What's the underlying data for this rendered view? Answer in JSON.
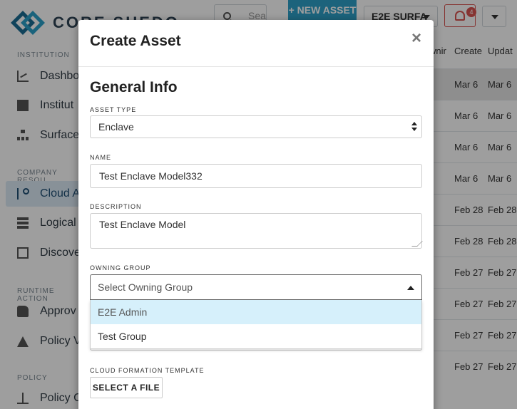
{
  "header": {
    "logo_text": "CORE SUEDO",
    "search_placeholder": "Sea",
    "new_asset_label": "+ NEW ASSET",
    "org_selector": "E2E SURFA",
    "notification_count": "4"
  },
  "sidebar": {
    "sections": [
      {
        "title": "INSTITUTION",
        "items": [
          {
            "label": "Dashbo",
            "icon": "chart-icon"
          },
          {
            "label": "Institut",
            "icon": "building-icon"
          },
          {
            "label": "Surface",
            "icon": "network-icon"
          }
        ]
      },
      {
        "title": "COMPANY RESOU",
        "items": [
          {
            "label": "Cloud A",
            "icon": "branch-icon"
          },
          {
            "label": "Logical",
            "icon": "server-icon"
          },
          {
            "label": "Discove",
            "icon": "discover-icon"
          }
        ]
      },
      {
        "title": "RUNTIME ACTION",
        "items": [
          {
            "label": "Approv",
            "icon": "thumbs-up-icon"
          },
          {
            "label": "Policy V",
            "icon": "warning-icon"
          }
        ]
      },
      {
        "title": "POLICY",
        "items": [
          {
            "label": "Policy C",
            "icon": "scale-icon"
          }
        ]
      }
    ]
  },
  "table": {
    "headers": [
      "wnir",
      "Create",
      "Updat"
    ],
    "rows": [
      {
        "created": "Mar 6",
        "updated": "Mar 6"
      },
      {
        "created": "Mar 6",
        "updated": "Mar 6"
      },
      {
        "created": "Mar 6",
        "updated": "Mar 6"
      },
      {
        "created": "Mar 6",
        "updated": "Mar 6"
      },
      {
        "created": "Feb 28",
        "updated": "Feb 28"
      },
      {
        "created": "Feb 28",
        "updated": "Feb 28"
      },
      {
        "created": "Feb 27",
        "updated": "Feb 27"
      },
      {
        "created": "Feb 27",
        "updated": "Feb 27"
      },
      {
        "created": "Feb 27",
        "updated": "Feb 27"
      },
      {
        "created": "Feb 27",
        "updated": "Feb 27"
      }
    ]
  },
  "modal": {
    "title": "Create Asset",
    "close_glyph": "×",
    "section_heading": "General Info",
    "asset_type": {
      "label": "ASSET TYPE",
      "value": "Enclave"
    },
    "name": {
      "label": "NAME",
      "value": "Test Enclave Model332"
    },
    "description": {
      "label": "DESCRIPTION",
      "value": "Test Enclave Model"
    },
    "owning_group": {
      "label": "OWNING GROUP",
      "placeholder": "Select Owning Group",
      "options": [
        "E2E Admin",
        "Test Group"
      ]
    },
    "cloud_formation": {
      "label": "CLOUD FORMATION TEMPLATE",
      "button_label": "SELECT A FILE"
    }
  }
}
